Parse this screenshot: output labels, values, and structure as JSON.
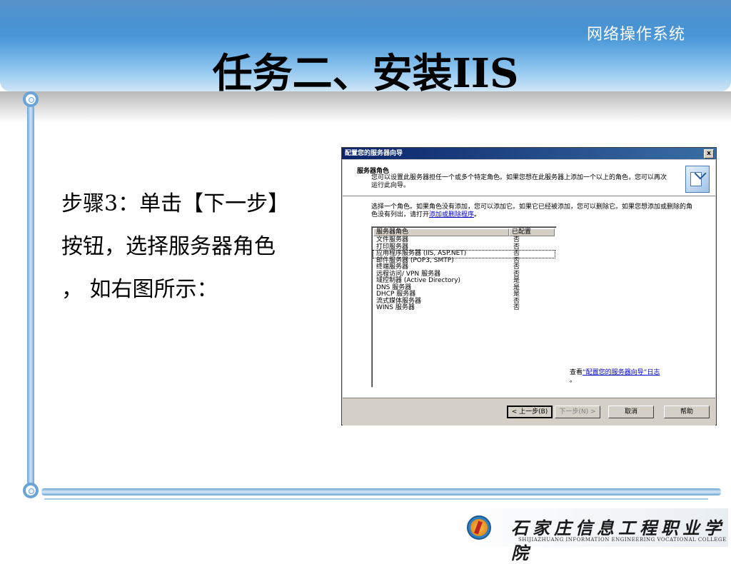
{
  "slide": {
    "subject": "网络操作系统",
    "title": "任务二、安装IIS",
    "step_line1": "步骤3：单击【下一步】",
    "step_line2": "按钮，选择服务器角色",
    "step_line3": "，  如右图所示："
  },
  "dialog": {
    "title": "配置您的服务器向导",
    "close_label": "x",
    "header_title": "服务器角色",
    "header_desc": "您可以设置此服务器担任一个或多个特定角色。如果您想在此服务器上添加一个以上的角色，您可以再次运行此向导。",
    "body_desc_prefix": "选择一个角色。如果角色没有添加，您可以添加它。如果它已经被添加，您可以删除它。如果您想添加或删除的角色没有列出，请打开",
    "body_desc_link": "添加或删除程序",
    "body_desc_suffix": "。",
    "list_headers": [
      "服务器角色",
      "已配置"
    ],
    "roles": [
      {
        "name": "文件服务器",
        "configured": "否"
      },
      {
        "name": "打印服务器",
        "configured": "否"
      },
      {
        "name": "应用程序服务器 (IIS, ASP.NET)",
        "configured": "否"
      },
      {
        "name": "邮件服务器 (POP3, SMTP)",
        "configured": "否"
      },
      {
        "name": "终端服务器",
        "configured": "否"
      },
      {
        "name": "远程访问/ VPN 服务器",
        "configured": "否"
      },
      {
        "name": "域控制器 (Active Directory)",
        "configured": "是"
      },
      {
        "name": "DNS 服务器",
        "configured": "是"
      },
      {
        "name": "DHCP 服务器",
        "configured": "是"
      },
      {
        "name": "流式媒体服务器",
        "configured": "否"
      },
      {
        "name": "WINS 服务器",
        "configured": "否"
      }
    ],
    "log_prefix": "查看",
    "log_link": "“配置您的服务器向导”日志",
    "log_suffix": "。",
    "buttons": {
      "back": "< 上一步(B)",
      "next": "下一步(N) >",
      "cancel": "取消",
      "help": "帮助"
    }
  },
  "logo": {
    "cn": "石家庄信息工程职业学院",
    "en": "SHIJIAZHUANG INFORMATION ENGINEERING VOCATIONAL COLLEGE"
  }
}
